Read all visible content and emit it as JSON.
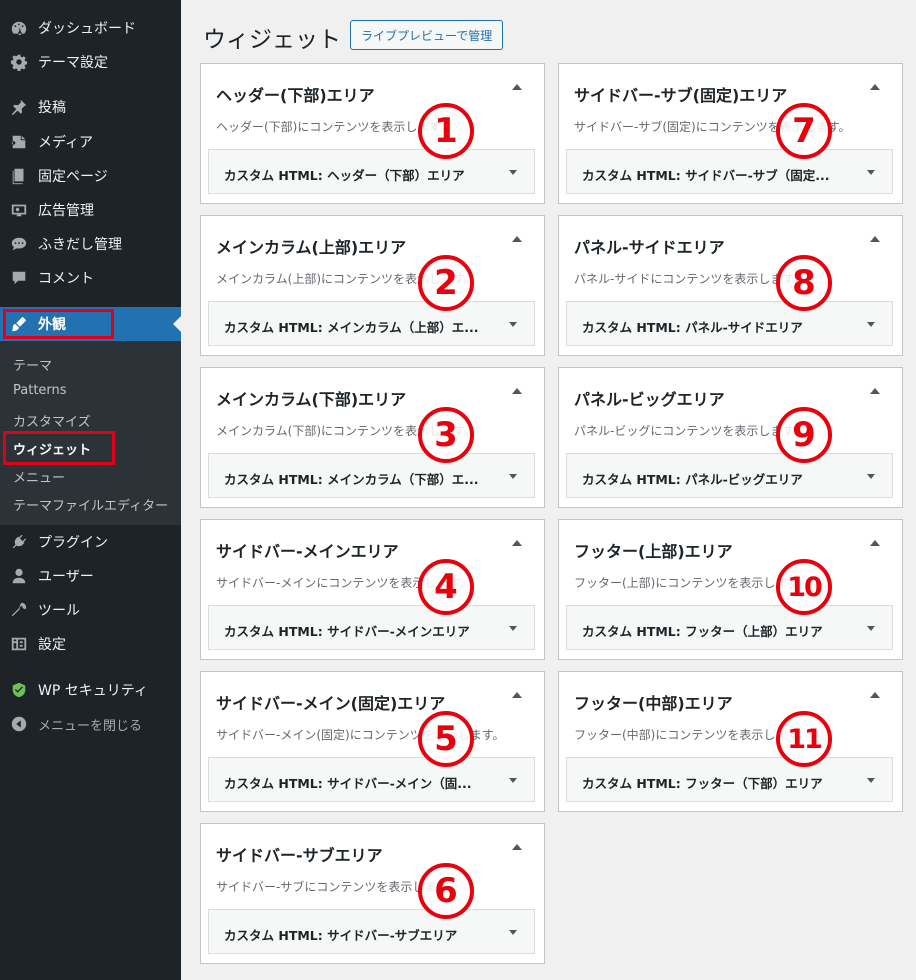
{
  "sidebar": {
    "items": [
      {
        "label": "ダッシュボード",
        "icon": "dashboard-icon"
      },
      {
        "label": "テーマ設定",
        "icon": "gear-icon"
      },
      {
        "label": "投稿",
        "icon": "pin-icon"
      },
      {
        "label": "メディア",
        "icon": "media-icon"
      },
      {
        "label": "固定ページ",
        "icon": "page-icon"
      },
      {
        "label": "広告管理",
        "icon": "ad-icon"
      },
      {
        "label": "ふきだし管理",
        "icon": "speech-bubble-icon"
      },
      {
        "label": "コメント",
        "icon": "comment-icon"
      },
      {
        "label": "外観",
        "icon": "brush-icon"
      },
      {
        "label": "プラグイン",
        "icon": "plugin-icon"
      },
      {
        "label": "ユーザー",
        "icon": "user-icon"
      },
      {
        "label": "ツール",
        "icon": "wrench-icon"
      },
      {
        "label": "設定",
        "icon": "settings-icon"
      },
      {
        "label": "WP セキュリティ",
        "icon": "shield-icon"
      },
      {
        "label": "メニューを閉じる",
        "icon": "collapse-icon"
      }
    ],
    "submenu": [
      "テーマ",
      "Patterns",
      "カスタマイズ",
      "ウィジェット",
      "メニュー",
      "テーマファイルエディター"
    ]
  },
  "main": {
    "title": "ウィジェット",
    "live_preview_label": "ライブプレビューで管理"
  },
  "areas": [
    {
      "title": "ヘッダー(下部)エリア",
      "desc": "ヘッダー(下部)にコンテンツを表示します。",
      "widget": "カスタム HTML: ヘッダー（下部）エリア",
      "marker": "1"
    },
    {
      "title": "メインカラム(上部)エリア",
      "desc": "メインカラム(上部)にコンテンツを表示します。",
      "widget": "カスタム HTML: メインカラム（上部）エ...",
      "marker": "2"
    },
    {
      "title": "メインカラム(下部)エリア",
      "desc": "メインカラム(下部)にコンテンツを表示します。",
      "widget": "カスタム HTML: メインカラム（下部）エ...",
      "marker": "3"
    },
    {
      "title": "サイドバー-メインエリア",
      "desc": "サイドバー-メインにコンテンツを表示します。",
      "widget": "カスタム HTML: サイドバー-メインエリア",
      "marker": "4"
    },
    {
      "title": "サイドバー-メイン(固定)エリア",
      "desc": "サイドバー-メイン(固定)にコンテンツを表示します。",
      "widget": "カスタム HTML: サイドバー-メイン（固...",
      "marker": "5"
    },
    {
      "title": "サイドバー-サブエリア",
      "desc": "サイドバー-サブにコンテンツを表示します。",
      "widget": "カスタム HTML: サイドバー-サブエリア",
      "marker": "6"
    },
    {
      "title": "サイドバー-サブ(固定)エリア",
      "desc": "サイドバー-サブ(固定)にコンテンツを表示します。",
      "widget": "カスタム HTML: サイドバー-サブ（固定...",
      "marker": "7"
    },
    {
      "title": "パネル-サイドエリア",
      "desc": "パネル-サイドにコンテンツを表示します。",
      "widget": "カスタム HTML: パネル-サイドエリア",
      "marker": "8"
    },
    {
      "title": "パネル-ビッグエリア",
      "desc": "パネル-ビッグにコンテンツを表示します。",
      "widget": "カスタム HTML: パネル-ビッグエリア",
      "marker": "9"
    },
    {
      "title": "フッター(上部)エリア",
      "desc": "フッター(上部)にコンテンツを表示します。",
      "widget": "カスタム HTML: フッター（上部）エリア",
      "marker": "10"
    },
    {
      "title": "フッター(中部)エリア",
      "desc": "フッター(中部)にコンテンツを表示します。",
      "widget": "カスタム HTML: フッター（下部）エリア",
      "marker": "11"
    }
  ],
  "colors": {
    "accent": "#2271b1",
    "sidebar_bg": "#1d2327",
    "highlight_red": "#e0001b"
  }
}
